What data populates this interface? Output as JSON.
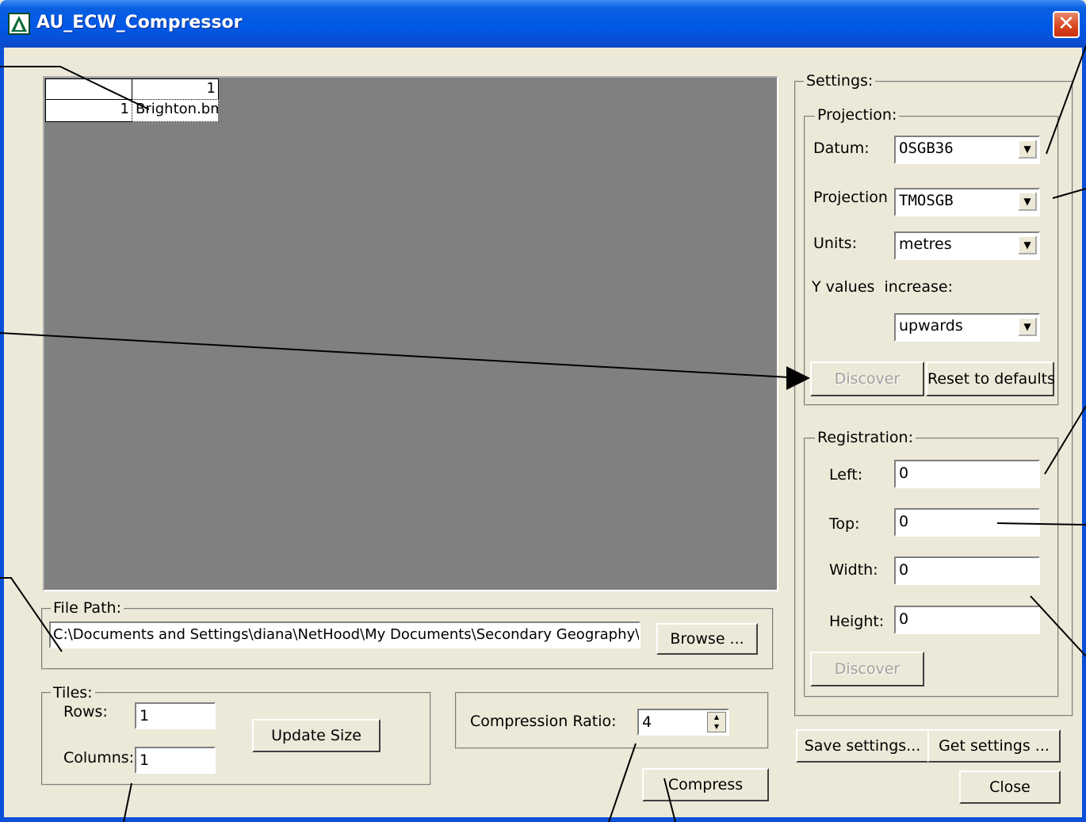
{
  "window": {
    "title": "AU_ECW_Compressor",
    "close_glyph": "✕"
  },
  "grid": {
    "col_header": "1",
    "row_header": "1",
    "cell": "Brighton.bmp"
  },
  "file_path": {
    "label": "File Path:",
    "value": "C:\\Documents and Settings\\diana\\NetHood\\My Documents\\Secondary Geography\\bright",
    "browse": "Browse ..."
  },
  "tiles": {
    "label": "Tiles:",
    "rows_label": "Rows:",
    "rows": "1",
    "columns_label": "Columns:",
    "columns": "1",
    "update": "Update Size"
  },
  "compression": {
    "label": "Compression Ratio:",
    "value": "4"
  },
  "compress_button": "Compress",
  "settings": {
    "label": "Settings:",
    "projection": {
      "label": "Projection:",
      "datum_label": "Datum:",
      "datum": "OSGB36",
      "projection_label": "Projection",
      "projection": "TMOSGB",
      "units_label": "Units:",
      "units": "metres",
      "yvalues_label": "Y values  increase:",
      "yvalues": "upwards",
      "discover": "Discover",
      "reset": "Reset to defaults"
    },
    "registration": {
      "label": "Registration:",
      "left_label": "Left:",
      "left": "0",
      "top_label": "Top:",
      "top": "0",
      "width_label": "Width:",
      "width": "0",
      "height_label": "Height:",
      "height": "0",
      "discover": "Discover"
    }
  },
  "save_settings": "Save settings...",
  "get_settings": "Get settings ...",
  "close_button": "Close"
}
